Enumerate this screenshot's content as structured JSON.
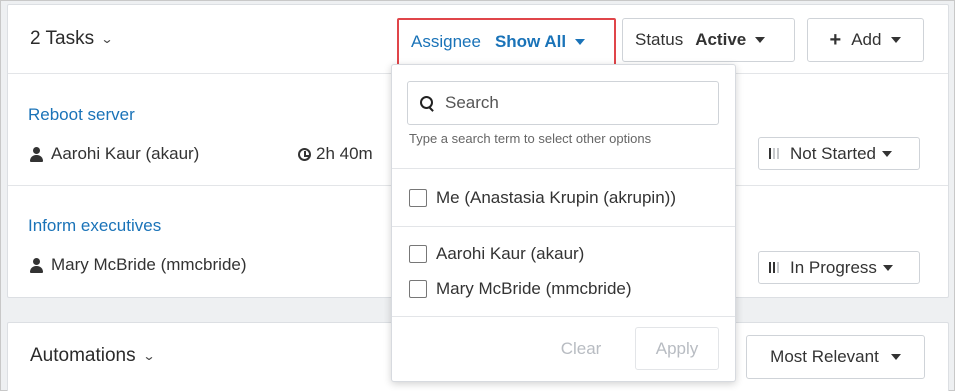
{
  "tasks": {
    "title": "2 Tasks",
    "assignee_filter": {
      "label": "Assignee",
      "value": "Show All"
    },
    "status_filter": {
      "label": "Status",
      "value": "Active"
    },
    "add_button": "Add",
    "items": [
      {
        "title": "Reboot server",
        "assignee": "Aarohi Kaur (akaur)",
        "time": "2h 40m",
        "status": "Not Started"
      },
      {
        "title": "Inform executives",
        "assignee": "Mary McBride (mmcbride)",
        "status": "In Progress"
      }
    ]
  },
  "automations": {
    "title": "Automations",
    "sort_value": "Most Relevant"
  },
  "assignee_dropdown": {
    "search_placeholder": "Search",
    "hint": "Type a search term to select other options",
    "me_option": "Me (Anastasia Krupin (akrupin))",
    "options": [
      "Aarohi Kaur (akaur)",
      "Mary McBride (mmcbride)"
    ],
    "clear_label": "Clear",
    "apply_label": "Apply"
  },
  "colors": {
    "link_blue": "#1a73b8",
    "highlight_red": "#e0454a"
  }
}
